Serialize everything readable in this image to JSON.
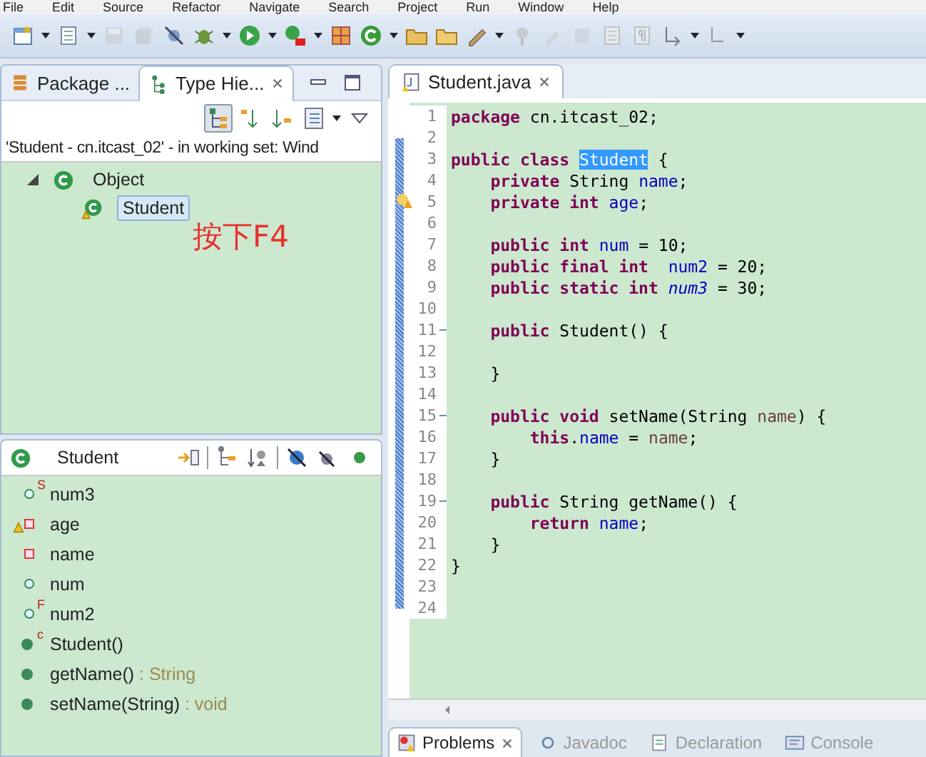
{
  "menu_bar": [
    "File",
    "Edit",
    "Source",
    "Refactor",
    "Navigate",
    "Search",
    "Project",
    "Run",
    "Window",
    "Help"
  ],
  "left_tabs": [
    {
      "label": "Package ...",
      "selected": false
    },
    {
      "label": "Type Hie...",
      "selected": true
    }
  ],
  "hierarchy": {
    "scope_label": "'Student - cn.itcast_02' - in working set: Wind",
    "tree": [
      {
        "label": "Object",
        "selected": false,
        "expanded": true,
        "children": [
          {
            "label": "Student",
            "selected": true
          }
        ]
      }
    ],
    "annotation": "按下F4"
  },
  "members": {
    "title": "Student",
    "items": [
      {
        "kind": "public-field",
        "modifier": "S",
        "warning": false,
        "label": "num3"
      },
      {
        "kind": "private-field",
        "warning": true,
        "label": "age"
      },
      {
        "kind": "private-field",
        "warning": false,
        "label": "name"
      },
      {
        "kind": "public-field",
        "warning": false,
        "label": "num"
      },
      {
        "kind": "public-field",
        "modifier": "F",
        "warning": false,
        "label": "num2"
      },
      {
        "kind": "public-method",
        "modifier": "c",
        "warning": false,
        "label": "Student()"
      },
      {
        "kind": "public-method",
        "warning": false,
        "label": "getName()",
        "type": " : String"
      },
      {
        "kind": "public-method",
        "warning": false,
        "label": "setName(String)",
        "type": " : void"
      }
    ]
  },
  "editor": {
    "tab": "Student.java",
    "lines": [
      {
        "number": "1",
        "tokens": [
          {
            "kind": "keyword",
            "text": "package"
          },
          {
            "kind": "plain",
            "text": " cn.itcast_02;"
          }
        ]
      },
      {
        "number": "2"
      },
      {
        "number": "3",
        "tokens": [
          {
            "kind": "keyword",
            "text": "public class "
          },
          {
            "kind": "selected",
            "text": "Student"
          },
          {
            "kind": "plain",
            "text": " {"
          }
        ]
      },
      {
        "number": "4",
        "tokens": [
          {
            "kind": "keyword",
            "text": "    private"
          },
          {
            "kind": "plain",
            "text": " String "
          },
          {
            "kind": "field",
            "text": "name"
          },
          {
            "kind": "plain",
            "text": ";"
          }
        ]
      },
      {
        "number": "5",
        "warning": true,
        "tokens": [
          {
            "kind": "keyword",
            "text": "    private int "
          },
          {
            "kind": "field",
            "text": "age"
          },
          {
            "kind": "plain",
            "text": ";"
          }
        ]
      },
      {
        "number": "6"
      },
      {
        "number": "7",
        "tokens": [
          {
            "kind": "keyword",
            "text": "    public int "
          },
          {
            "kind": "field",
            "text": "num"
          },
          {
            "kind": "plain",
            "text": " = 10;"
          }
        ]
      },
      {
        "number": "8",
        "tokens": [
          {
            "kind": "keyword",
            "text": "    public final int  "
          },
          {
            "kind": "field",
            "text": "num2"
          },
          {
            "kind": "plain",
            "text": " = 20;"
          }
        ]
      },
      {
        "number": "9",
        "tokens": [
          {
            "kind": "keyword",
            "text": "    public static int "
          },
          {
            "kind": "static",
            "text": "num3"
          },
          {
            "kind": "plain",
            "text": " = 30;"
          }
        ]
      },
      {
        "number": "10"
      },
      {
        "number": "11",
        "fold": true,
        "tokens": [
          {
            "kind": "keyword",
            "text": "    public"
          },
          {
            "kind": "plain",
            "text": " Student() {"
          }
        ]
      },
      {
        "number": "12"
      },
      {
        "number": "13",
        "tokens": [
          {
            "kind": "plain",
            "text": "    }"
          }
        ]
      },
      {
        "number": "14"
      },
      {
        "number": "15",
        "fold": true,
        "tokens": [
          {
            "kind": "keyword",
            "text": "    public void"
          },
          {
            "kind": "plain",
            "text": " setName(String "
          },
          {
            "kind": "param",
            "text": "name"
          },
          {
            "kind": "plain",
            "text": ") {"
          }
        ]
      },
      {
        "number": "16",
        "tokens": [
          {
            "kind": "keyword",
            "text": "        this"
          },
          {
            "kind": "plain",
            "text": "."
          },
          {
            "kind": "field",
            "text": "name"
          },
          {
            "kind": "plain",
            "text": " = "
          },
          {
            "kind": "param",
            "text": "name"
          },
          {
            "kind": "plain",
            "text": ";"
          }
        ]
      },
      {
        "number": "17",
        "tokens": [
          {
            "kind": "plain",
            "text": "    }"
          }
        ]
      },
      {
        "number": "18"
      },
      {
        "number": "19",
        "fold": true,
        "tokens": [
          {
            "kind": "keyword",
            "text": "    public"
          },
          {
            "kind": "plain",
            "text": " String getName() {"
          }
        ]
      },
      {
        "number": "20",
        "tokens": [
          {
            "kind": "keyword",
            "text": "        return "
          },
          {
            "kind": "field",
            "text": "name"
          },
          {
            "kind": "plain",
            "text": ";"
          }
        ]
      },
      {
        "number": "21",
        "tokens": [
          {
            "kind": "plain",
            "text": "    }"
          }
        ]
      },
      {
        "number": "22",
        "tokens": [
          {
            "kind": "plain",
            "text": "}"
          }
        ]
      },
      {
        "number": "23"
      },
      {
        "number": "24"
      }
    ]
  },
  "bottom_tabs": [
    {
      "label": "Problems",
      "selected": true
    },
    {
      "label": "Javadoc",
      "selected": false
    },
    {
      "label": "Declaration",
      "selected": false
    },
    {
      "label": "Console",
      "selected": false
    }
  ]
}
